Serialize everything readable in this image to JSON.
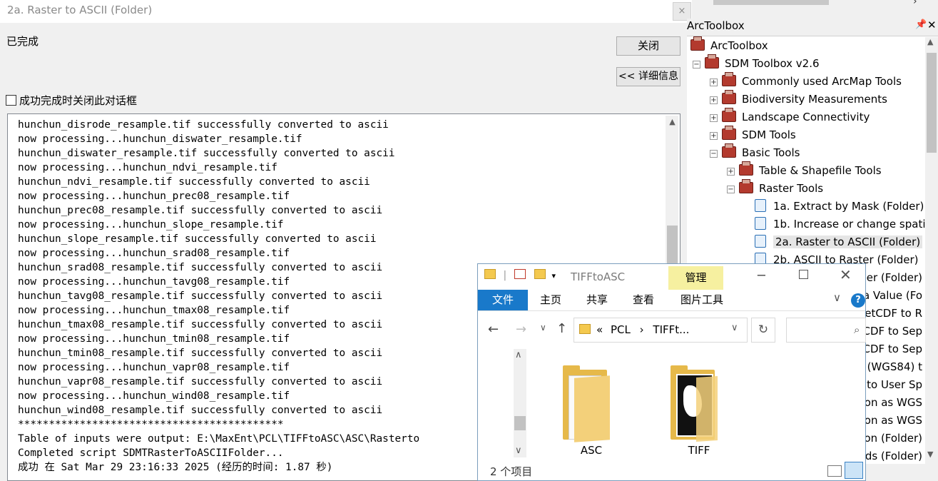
{
  "dialog": {
    "title": "2a. Raster to ASCII (Folder)",
    "close_glyph": "×",
    "status": "已完成",
    "close_button": "关闭",
    "details_button": "<< 详细信息",
    "autoclose_label": "成功完成时关闭此对话框",
    "scroll_up_glyph": "▲",
    "log": [
      "hunchun_disrode_resample.tif successfully converted to ascii",
      "now processing...hunchun_diswater_resample.tif",
      "hunchun_diswater_resample.tif successfully converted to ascii",
      "now processing...hunchun_ndvi_resample.tif",
      "hunchun_ndvi_resample.tif successfully converted to ascii",
      "now processing...hunchun_prec08_resample.tif",
      "hunchun_prec08_resample.tif successfully converted to ascii",
      "now processing...hunchun_slope_resample.tif",
      "hunchun_slope_resample.tif successfully converted to ascii",
      "now processing...hunchun_srad08_resample.tif",
      "hunchun_srad08_resample.tif successfully converted to ascii",
      "now processing...hunchun_tavg08_resample.tif",
      "hunchun_tavg08_resample.tif successfully converted to ascii",
      "now processing...hunchun_tmax08_resample.tif",
      "hunchun_tmax08_resample.tif successfully converted to ascii",
      "now processing...hunchun_tmin08_resample.tif",
      "hunchun_tmin08_resample.tif successfully converted to ascii",
      "now processing...hunchun_vapr08_resample.tif",
      "hunchun_vapr08_resample.tif successfully converted to ascii",
      "now processing...hunchun_wind08_resample.tif",
      "hunchun_wind08_resample.tif successfully converted to ascii",
      "*******************************************",
      "Table of inputs were output: E:\\MaxEnt\\PCL\\TIFFtoASC\\ASC\\Rasterto",
      "Completed script SDMTRasterToASCIIFolder...",
      "成功 在 Sat Mar 29 23:16:33 2025 (经历的时间: 1.87 秒)"
    ]
  },
  "toolbox": {
    "top_chevron": "›",
    "header_title": "ArcToolbox",
    "pin_glyph": "📌",
    "close_glyph": "✕",
    "scroll_up_glyph": "▲",
    "scroll_down_glyph": "▼",
    "tree": [
      {
        "label": "ArcToolbox",
        "expander": "",
        "icon": "toolbox"
      },
      {
        "label": "SDM Toolbox v2.6",
        "expander": "⊟",
        "icon": "toolbox"
      },
      {
        "label": "Commonly used ArcMap Tools",
        "expander": "+",
        "icon": "toolbox"
      },
      {
        "label": "Biodiversity Measurements",
        "expander": "+",
        "icon": "toolbox"
      },
      {
        "label": "Landscape Connectivity",
        "expander": "+",
        "icon": "toolbox"
      },
      {
        "label": "SDM Tools",
        "expander": "+",
        "icon": "toolbox"
      },
      {
        "label": "Basic Tools",
        "expander": "−",
        "icon": "toolbox"
      },
      {
        "label": "Table & Shapefile Tools",
        "expander": "+",
        "icon": "toolbox"
      },
      {
        "label": "Raster Tools",
        "expander": "−",
        "icon": "toolbox"
      },
      {
        "label": "1a. Extract by Mask (Folder)",
        "expander": "",
        "icon": "script"
      },
      {
        "label": "1b. Increase or change spati",
        "expander": "",
        "icon": "script"
      },
      {
        "label": "2a. Raster to ASCII (Folder)",
        "expander": "",
        "icon": "script"
      },
      {
        "label": "2b. ASCII to Raster (Folder)",
        "expander": "",
        "icon": "script"
      },
      {
        "label": "er (Folder)",
        "expander": "",
        "icon": "none"
      },
      {
        "label": "a Value (Fo",
        "expander": "",
        "icon": "none"
      },
      {
        "label": "letCDF to R",
        "expander": "",
        "icon": "none"
      },
      {
        "label": "CDF to Sep",
        "expander": "",
        "icon": "none"
      },
      {
        "label": "tCDF to Sep",
        "expander": "",
        "icon": "none"
      },
      {
        "label": "r (WGS84) t",
        "expander": "",
        "icon": "none"
      },
      {
        "label": "r to User Sp",
        "expander": "",
        "icon": "none"
      },
      {
        "label": "tion as WGS",
        "expander": "",
        "icon": "none"
      },
      {
        "label": "ation as WGS",
        "expander": "",
        "icon": "none"
      },
      {
        "label": "tion (Folder)",
        "expander": "",
        "icon": "none"
      },
      {
        "label": "ds (Folder)",
        "expander": "",
        "icon": "none"
      }
    ]
  },
  "explorer": {
    "title": "TIFFtoASC",
    "qat_separator": "|",
    "qat_dropdown": "▾",
    "manage_tab": "管理",
    "minimize_glyph": "─",
    "close_glyph": "✕",
    "ribbon_tabs": [
      "文件",
      "主页",
      "共享",
      "查看",
      "图片工具"
    ],
    "ribbon_chevron": "∨",
    "help_glyph": "?",
    "back_glyph": "←",
    "forward_glyph": "→",
    "recent_glyph": "∨",
    "up_glyph": "↑",
    "address_prefix": "«",
    "breadcrumb": [
      "PCL",
      "TIFFt..."
    ],
    "breadcrumb_separator": "›",
    "address_dropdown": "∨",
    "refresh_glyph": "↻",
    "search_placeholder": "",
    "search_glyph": "⌕",
    "scroll_up_glyph": "∧",
    "scroll_down_glyph": "∨",
    "items": [
      {
        "name": "ASC",
        "kind": "folder"
      },
      {
        "name": "TIFF",
        "kind": "image-folder"
      }
    ],
    "status": "2 个项目"
  }
}
